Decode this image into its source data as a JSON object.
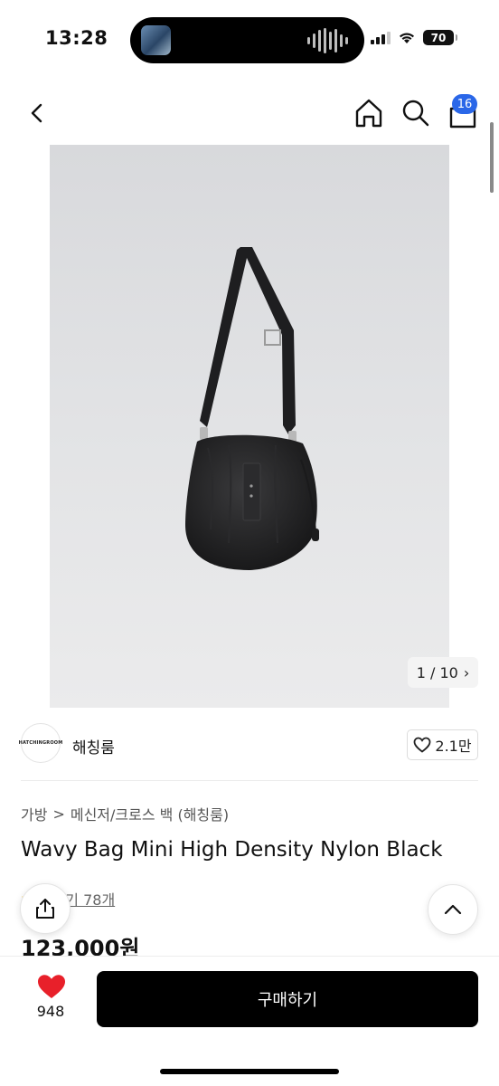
{
  "status_bar": {
    "time": "13:28",
    "battery": "70"
  },
  "nav": {
    "cart_count": "16"
  },
  "gallery": {
    "counter": "1 / 10",
    "next_glyph": "›"
  },
  "brand": {
    "logo_text": "HATCHINGROOM",
    "name": "해칭룸",
    "likes": "2.1만"
  },
  "breadcrumb": {
    "category": "가방",
    "separator": ">",
    "subcategory": "메신저/크로스 백 (해칭룸)"
  },
  "product": {
    "title": "Wavy Bag Mini High Density Nylon Black",
    "rating_stars": "★",
    "reviews": "후기 78개",
    "price": "123,000원"
  },
  "bottom": {
    "wish_count": "948",
    "buy_label": "구매하기"
  },
  "colors": {
    "badge": "#2a67e8",
    "heart": "#e8202a",
    "buy_bg": "#000000"
  }
}
